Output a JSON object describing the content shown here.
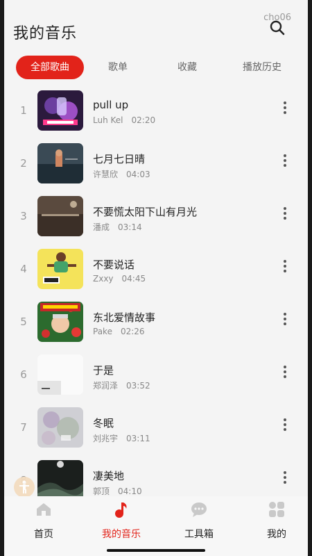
{
  "header": {
    "title": "我的音乐",
    "search_overlay_text": "cho06"
  },
  "tabs": [
    {
      "label": "全部歌曲",
      "active": true
    },
    {
      "label": "歌单",
      "active": false
    },
    {
      "label": "收藏",
      "active": false
    },
    {
      "label": "播放历史",
      "active": false
    }
  ],
  "songs": [
    {
      "index": "1",
      "title": "pull up",
      "artist": "Luh Kel",
      "duration": "02:20"
    },
    {
      "index": "2",
      "title": "七月七日晴",
      "artist": "许慧欣",
      "duration": "04:03"
    },
    {
      "index": "3",
      "title": "不要慌太阳下山有月光",
      "artist": "潘成",
      "duration": "03:14"
    },
    {
      "index": "4",
      "title": "不要说话",
      "artist": "Zxxy",
      "duration": "04:45"
    },
    {
      "index": "5",
      "title": "东北爱情故事",
      "artist": "Pake",
      "duration": "02:26"
    },
    {
      "index": "6",
      "title": "于是",
      "artist": "郑润泽",
      "duration": "03:52"
    },
    {
      "index": "7",
      "title": "冬眠",
      "artist": "刘兆宇",
      "duration": "03:11"
    },
    {
      "index": "8",
      "title": "凄美地",
      "artist": "郭顶",
      "duration": "04:10"
    }
  ],
  "bottom_nav": [
    {
      "label": "首页",
      "icon": "home-icon",
      "active": false
    },
    {
      "label": "我的音乐",
      "icon": "music-note-icon",
      "active": true
    },
    {
      "label": "工具箱",
      "icon": "chat-bubble-icon",
      "active": false
    },
    {
      "label": "我的",
      "icon": "profile-grid-icon",
      "active": false
    }
  ],
  "colors": {
    "accent": "#e2231a",
    "background": "#f4f4f4"
  }
}
